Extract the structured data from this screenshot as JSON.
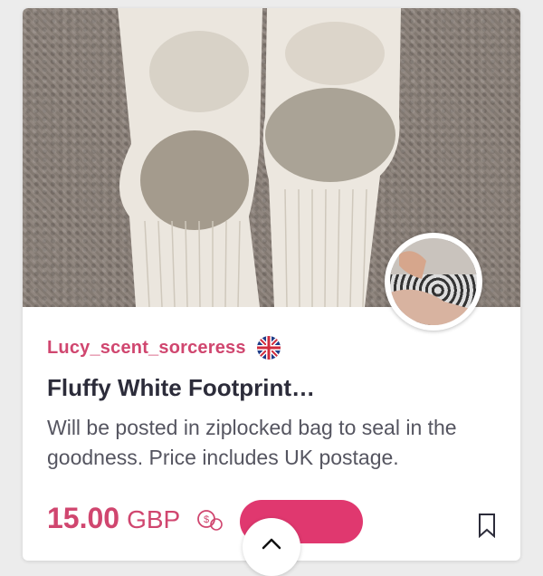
{
  "listing": {
    "seller_name": "Lucy_scent_sorceress",
    "seller_country_flag": "uk-flag-icon",
    "title": "Fluffy White Footprint…",
    "description": "Will be posted in ziplocked bag to seal in the goodness. Price includes UK postage.",
    "price": "15.00",
    "currency": "GBP"
  },
  "colors": {
    "accent": "#d0466f",
    "pill": "#e0386f",
    "title_text": "#2c2c3a",
    "body_text": "#555560"
  },
  "icons": {
    "offer": "offer-chat-icon",
    "bookmark": "bookmark-icon",
    "scroll_top": "chevron-up-icon"
  }
}
